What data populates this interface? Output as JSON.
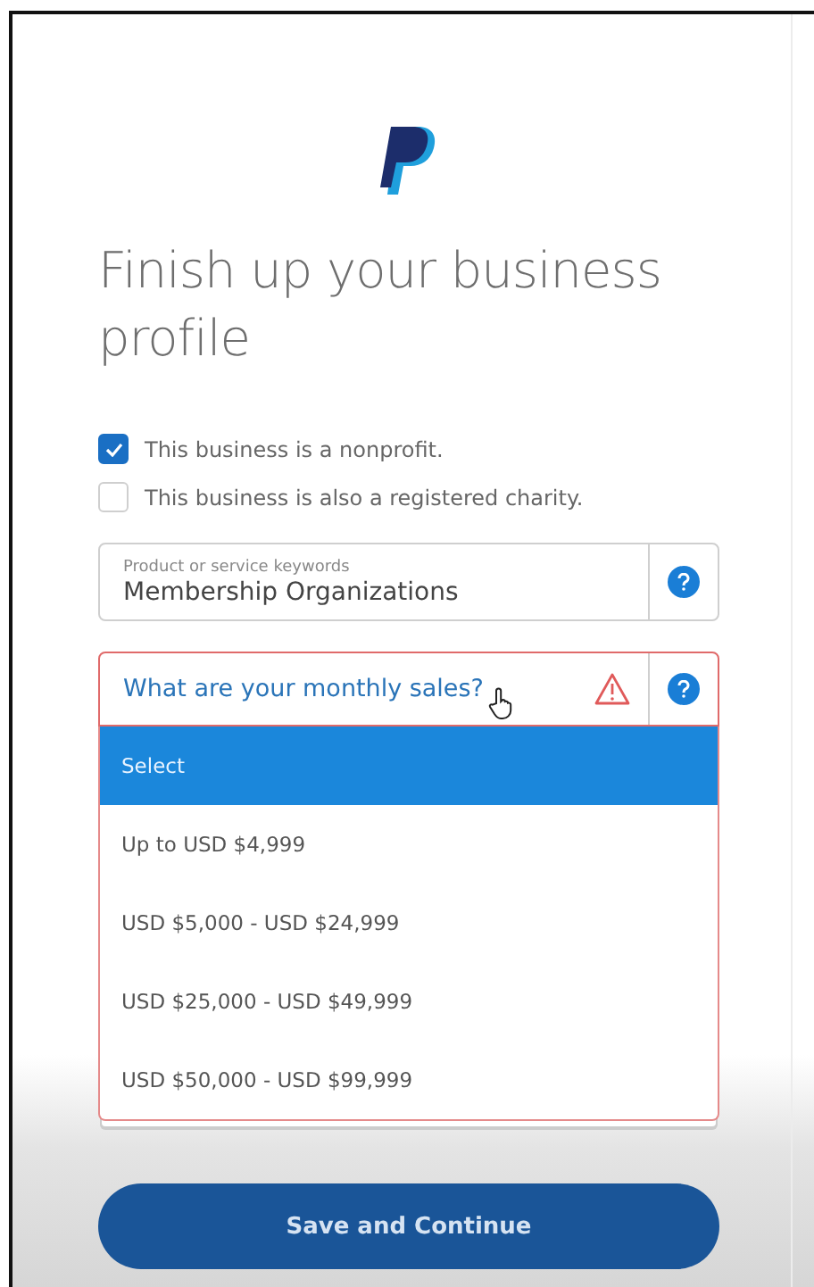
{
  "title": "Finish up your business profile",
  "checkboxes": [
    {
      "label": "This business is a nonprofit.",
      "checked": true
    },
    {
      "label": "This business is also a registered charity.",
      "checked": false
    }
  ],
  "keywords_field": {
    "label": "Product or service keywords",
    "value": "Membership Organizations"
  },
  "sales_select": {
    "label": "What are your monthly sales?",
    "error": true,
    "expanded": true,
    "options": [
      {
        "label": "Select",
        "selected": true
      },
      {
        "label": "Up to USD $4,999",
        "selected": false
      },
      {
        "label": "USD $5,000 - USD $24,999",
        "selected": false
      },
      {
        "label": "USD $25,000 - USD $49,999",
        "selected": false
      },
      {
        "label": "USD $50,000 - USD $99,999",
        "selected": false
      }
    ]
  },
  "button": "Save and Continue"
}
